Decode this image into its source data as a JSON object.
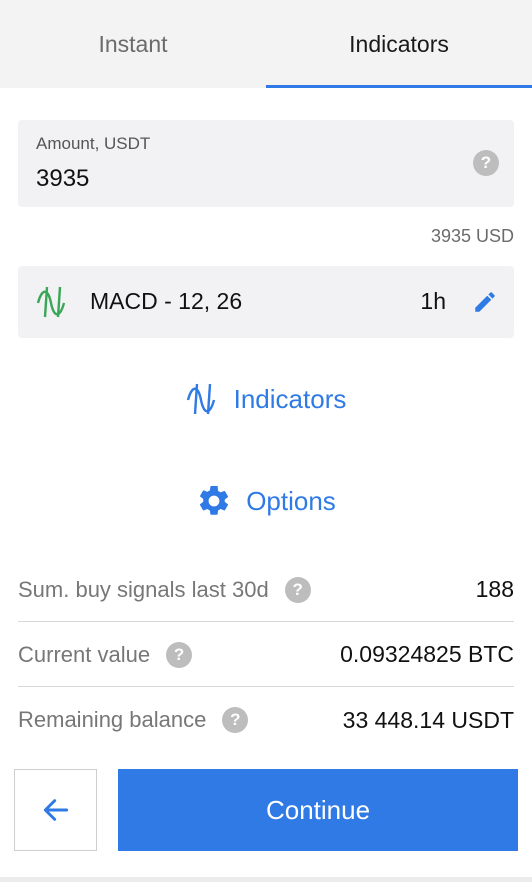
{
  "tabs": [
    {
      "label": "Instant",
      "active": false
    },
    {
      "label": "Indicators",
      "active": true
    }
  ],
  "amount": {
    "label": "Amount, USDT",
    "value": "3935",
    "help": "?",
    "usd_note": "3935 USD"
  },
  "indicator": {
    "name": "MACD - 12, 26",
    "timeframe": "1h",
    "icon": "wave-icon",
    "edit_icon": "pencil-icon"
  },
  "actions": {
    "indicators_label": "Indicators",
    "options_label": "Options"
  },
  "stats": [
    {
      "label": "Sum. buy signals last 30d",
      "value": "188",
      "help": "?"
    },
    {
      "label": "Current value",
      "value": "0.09324825 BTC",
      "help": "?"
    },
    {
      "label": "Remaining balance",
      "value": "33 448.14 USDT",
      "help": "?"
    }
  ],
  "footer": {
    "back_icon": "arrow-left-icon",
    "continue_label": "Continue"
  },
  "colors": {
    "accent": "#2f7ae5",
    "indicator_icon": "#3aa657",
    "panel_bg": "#f2f2f4"
  }
}
